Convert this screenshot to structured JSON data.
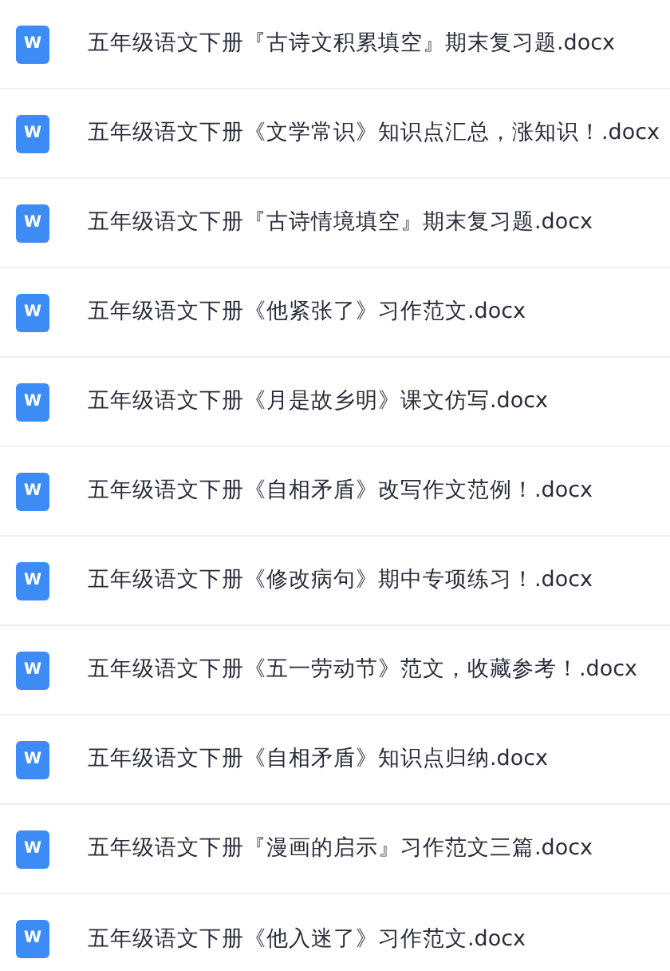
{
  "files": [
    {
      "icon_letter": "W",
      "name": "五年级语文下册『古诗文积累填空』期末复习题.docx"
    },
    {
      "icon_letter": "W",
      "name": "五年级语文下册《文学常识》知识点汇总，涨知识！.docx"
    },
    {
      "icon_letter": "W",
      "name": "五年级语文下册『古诗情境填空』期末复习题.docx"
    },
    {
      "icon_letter": "W",
      "name": "五年级语文下册《他紧张了》习作范文.docx"
    },
    {
      "icon_letter": "W",
      "name": "五年级语文下册《月是故乡明》课文仿写.docx"
    },
    {
      "icon_letter": "W",
      "name": "五年级语文下册《自相矛盾》改写作文范例！.docx"
    },
    {
      "icon_letter": "W",
      "name": "五年级语文下册《修改病句》期中专项练习！.docx"
    },
    {
      "icon_letter": "W",
      "name": "五年级语文下册《五一劳动节》范文，收藏参考！.docx"
    },
    {
      "icon_letter": "W",
      "name": "五年级语文下册《自相矛盾》知识点归纳.docx"
    },
    {
      "icon_letter": "W",
      "name": "五年级语文下册『漫画的启示』习作范文三篇.docx"
    },
    {
      "icon_letter": "W",
      "name": "五年级语文下册《他入迷了》习作范文.docx"
    }
  ]
}
